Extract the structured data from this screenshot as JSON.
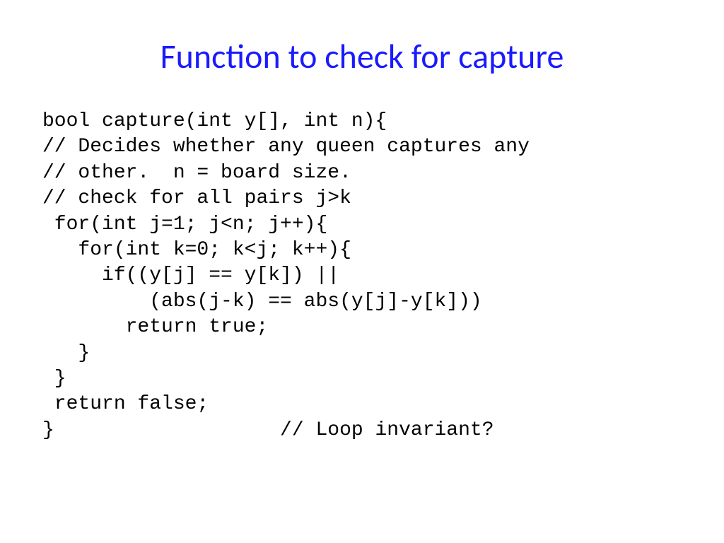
{
  "slide": {
    "title": "Function to check for capture",
    "code": "bool capture(int y[], int n){\n// Decides whether any queen captures any\n// other.  n = board size.\n// check for all pairs j>k\n for(int j=1; j<n; j++){\n   for(int k=0; k<j; k++){\n     if((y[j] == y[k]) ||\n         (abs(j-k) == abs(y[j]-y[k]))\n       return true;\n   }\n }\n return false;\n}                   // Loop invariant?"
  }
}
